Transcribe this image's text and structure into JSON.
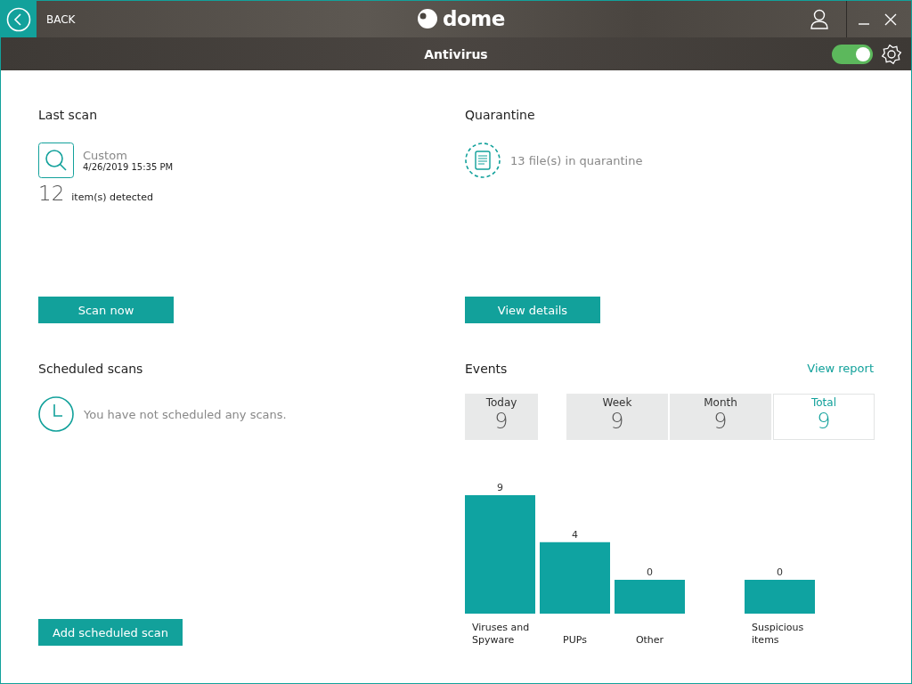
{
  "title_bar": {
    "back_label": "BACK",
    "logo_text": "dome"
  },
  "sub_header": {
    "title": "Antivirus",
    "toggle": {
      "on": true
    }
  },
  "last_scan": {
    "heading": "Last scan",
    "scan_type": "Custom",
    "date": "4/26/2019 15:35 PM",
    "count": "12",
    "count_label": "item(s) detected",
    "button": "Scan now"
  },
  "quarantine": {
    "heading": "Quarantine",
    "text": "13 file(s) in quarantine",
    "button": "View details"
  },
  "scheduled_scans": {
    "heading": "Scheduled scans",
    "text": "You have not scheduled any scans.",
    "button": "Add scheduled scan"
  },
  "events": {
    "heading": "Events",
    "link": "View report",
    "tabs": [
      {
        "label": "Today",
        "value": "9",
        "selected": false
      },
      {
        "label": "Week",
        "value": "9",
        "selected": false
      },
      {
        "label": "Month",
        "value": "9",
        "selected": false
      },
      {
        "label": "Total",
        "value": "9",
        "selected": true
      }
    ],
    "bars": [
      {
        "label": "Viruses and Spyware",
        "value": "9"
      },
      {
        "label": "PUPs",
        "value": "4"
      },
      {
        "label": "Other",
        "value": "0"
      },
      {
        "label": "Suspicious items",
        "value": "0"
      }
    ]
  }
}
